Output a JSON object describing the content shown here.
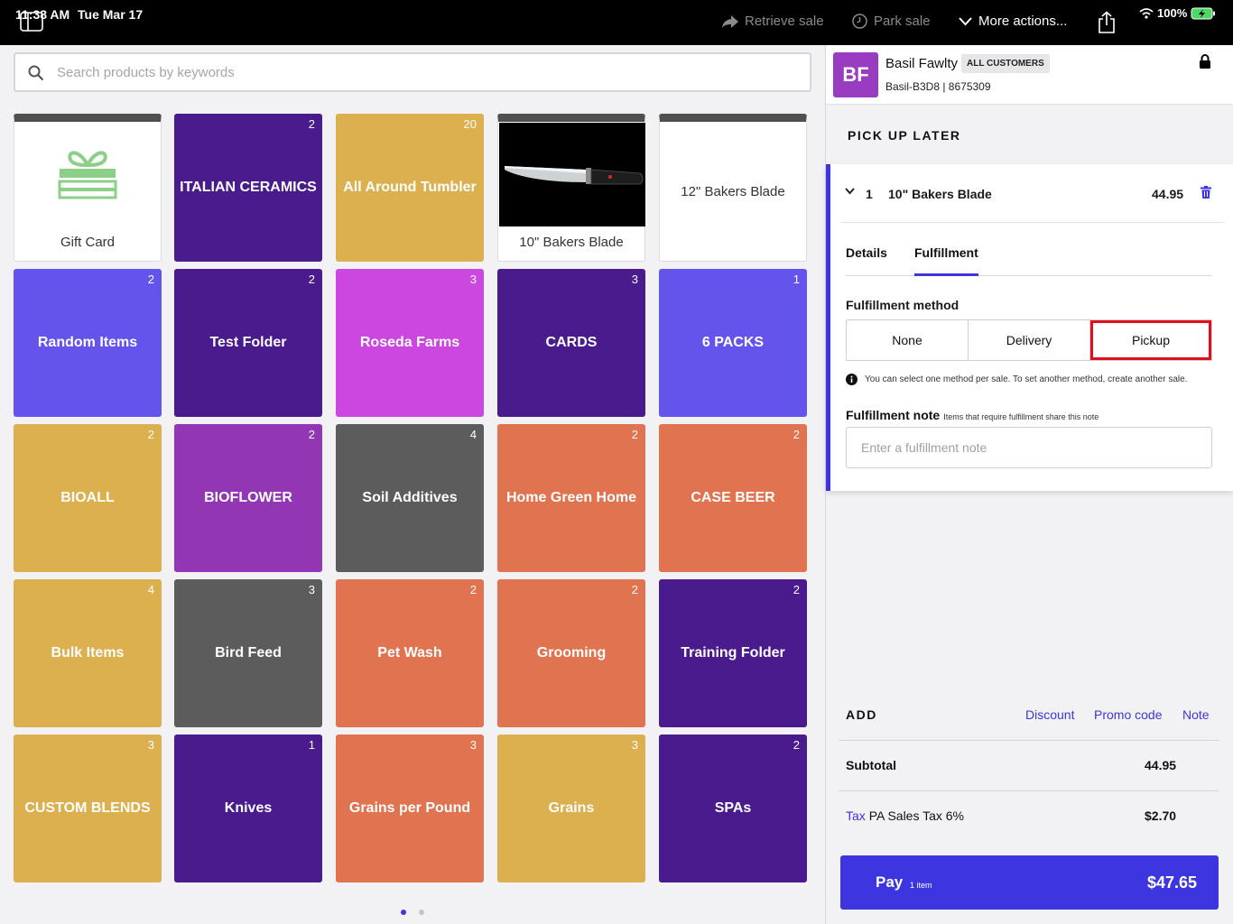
{
  "status_bar": {
    "time": "11:38 AM",
    "date": "Tue Mar 17",
    "battery": "100%"
  },
  "toolbar": {
    "retrieve_sale": "Retrieve sale",
    "park_sale": "Park sale",
    "more_actions": "More actions..."
  },
  "search": {
    "placeholder": "Search products by keywords"
  },
  "tiles": [
    {
      "label": "Gift Card",
      "count": "",
      "color": "#ffffff",
      "kind": "gift"
    },
    {
      "label": "ITALIAN CERAMICS",
      "count": "2",
      "color": "#4a1b8c"
    },
    {
      "label": "All Around Tumbler",
      "count": "20",
      "color": "#dcb04e"
    },
    {
      "label": "10\" Bakers Blade",
      "count": "",
      "color": "#ffffff",
      "kind": "image"
    },
    {
      "label": "12\" Bakers Blade",
      "count": "",
      "color": "#ffffff",
      "kind": "plain"
    },
    {
      "label": "Random Items",
      "count": "2",
      "color": "#6554ec"
    },
    {
      "label": "Test Folder",
      "count": "2",
      "color": "#4a1b8c"
    },
    {
      "label": "Roseda Farms",
      "count": "3",
      "color": "#cc47e0"
    },
    {
      "label": "CARDS",
      "count": "3",
      "color": "#4a1b8c"
    },
    {
      "label": "6 PACKS",
      "count": "1",
      "color": "#6554ec"
    },
    {
      "label": "BIOALL",
      "count": "2",
      "color": "#dcb04e"
    },
    {
      "label": "BIOFLOWER",
      "count": "2",
      "color": "#9236b3"
    },
    {
      "label": "Soil Additives",
      "count": "4",
      "color": "#5c5c5c"
    },
    {
      "label": "Home Green Home",
      "count": "2",
      "color": "#e07350"
    },
    {
      "label": "CASE BEER",
      "count": "2",
      "color": "#e07350"
    },
    {
      "label": "Bulk Items",
      "count": "4",
      "color": "#dcb04e"
    },
    {
      "label": "Bird Feed",
      "count": "3",
      "color": "#5c5c5c"
    },
    {
      "label": "Pet Wash",
      "count": "2",
      "color": "#e07350"
    },
    {
      "label": "Grooming",
      "count": "2",
      "color": "#e07350"
    },
    {
      "label": "Training Folder",
      "count": "2",
      "color": "#4a1b8c"
    },
    {
      "label": "CUSTOM BLENDS",
      "count": "3",
      "color": "#dcb04e"
    },
    {
      "label": "Knives",
      "count": "1",
      "color": "#4a1b8c"
    },
    {
      "label": "Grains per Pound",
      "count": "3",
      "color": "#e07350"
    },
    {
      "label": "Grains",
      "count": "3",
      "color": "#dcb04e"
    },
    {
      "label": "SPAs",
      "count": "2",
      "color": "#4a1b8c"
    }
  ],
  "customer": {
    "initials": "BF",
    "name": "Basil Fawlty",
    "group": "ALL CUSTOMERS",
    "code": "Basil-B3D8 | 8675309"
  },
  "sale": {
    "section_title": "PICK UP LATER",
    "line_item": {
      "qty": "1",
      "name": "10\" Bakers Blade",
      "price": "44.95"
    },
    "tabs": [
      "Details",
      "Fulfillment"
    ],
    "fulfillment_method_label": "Fulfillment method",
    "methods": [
      "None",
      "Delivery",
      "Pickup"
    ],
    "selected_method": "Pickup",
    "info_text": "You can select one method per sale. To set another method, create another sale.",
    "note_label": "Fulfillment note",
    "note_hint": "Items that require fulfillment share this note",
    "note_placeholder": "Enter a fulfillment note"
  },
  "totals": {
    "add_title": "ADD",
    "discount": "Discount",
    "promo_code": "Promo code",
    "note": "Note",
    "subtotal_label": "Subtotal",
    "subtotal": "44.95",
    "tax_link": "Tax",
    "tax_label": "PA Sales Tax 6%",
    "tax": "$2.70",
    "pay_label": "Pay",
    "pay_items": "1 item",
    "pay_total": "$47.65"
  },
  "colors": {
    "accent": "#3d35e0",
    "highlight": "#e0101c"
  }
}
